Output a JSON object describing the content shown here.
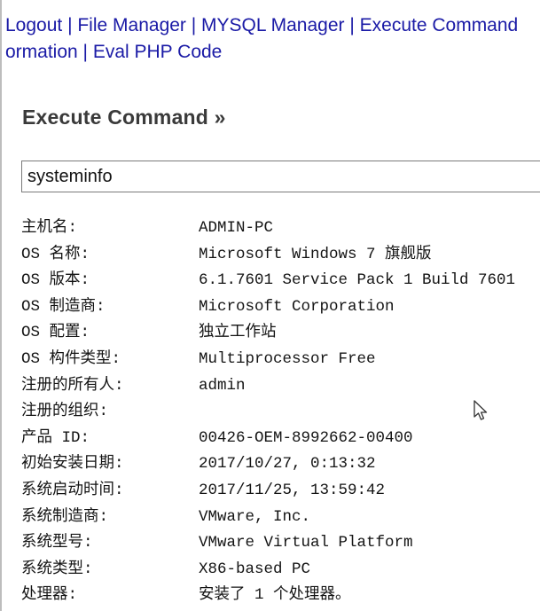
{
  "nav": {
    "line1": [
      {
        "id": "logout",
        "label": "Logout"
      },
      {
        "id": "file-manager",
        "label": "File Manager"
      },
      {
        "id": "mysql-manager",
        "label": "MYSQL Manager"
      },
      {
        "id": "execute-command",
        "label": "Execute Command"
      }
    ],
    "line2": [
      {
        "id": "server-information",
        "label": "ormation"
      },
      {
        "id": "eval-php-code",
        "label": "Eval PHP Code"
      }
    ],
    "separator": " | "
  },
  "section": {
    "title": "Execute Command »"
  },
  "command": {
    "value": "systeminfo"
  },
  "output": {
    "rows": [
      {
        "key": "主机名:",
        "value": "ADMIN-PC"
      },
      {
        "key": "OS 名称:",
        "value": "Microsoft Windows 7 旗舰版"
      },
      {
        "key": "OS 版本:",
        "value": "6.1.7601 Service Pack 1 Build 7601"
      },
      {
        "key": "OS 制造商:",
        "value": "Microsoft Corporation"
      },
      {
        "key": "OS 配置:",
        "value": "独立工作站"
      },
      {
        "key": "OS 构件类型:",
        "value": "Multiprocessor Free"
      },
      {
        "key": "注册的所有人:",
        "value": "admin"
      },
      {
        "key": "注册的组织:",
        "value": ""
      },
      {
        "key": "产品 ID:",
        "value": "00426-OEM-8992662-00400"
      },
      {
        "key": "初始安装日期:",
        "value": "2017/10/27, 0:13:32"
      },
      {
        "key": "系统启动时间:",
        "value": "2017/11/25, 13:59:42"
      },
      {
        "key": "系统制造商:",
        "value": "VMware, Inc."
      },
      {
        "key": "系统型号:",
        "value": "VMware Virtual Platform"
      },
      {
        "key": "系统类型:",
        "value": "X86-based PC"
      },
      {
        "key": "处理器:",
        "value": "安装了 1 个处理器。"
      }
    ]
  },
  "icons": {
    "cursor": "mouse-pointer-icon"
  },
  "colors": {
    "link": "#1a1aa6",
    "title": "#3a3a3a",
    "text": "#141414",
    "input_border": "#7a7a7a"
  }
}
